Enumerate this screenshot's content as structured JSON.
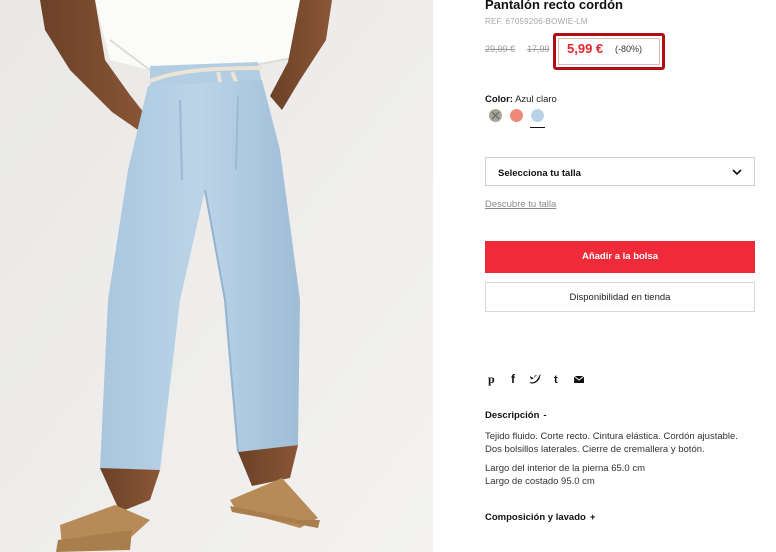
{
  "product": {
    "title": "Pantalón recto cordón",
    "ref": "REF. 67059206-BOWIE-LM",
    "old_prices": [
      "29,99 €",
      "17,99"
    ],
    "sale_price": "5,99 €",
    "discount": "(-80%)"
  },
  "color": {
    "label": "Color:",
    "value": "Azul claro",
    "swatches": [
      {
        "name": "Gris",
        "hex": "#a9a398",
        "available": false
      },
      {
        "name": "Coral",
        "hex": "#ee8a78",
        "available": true
      },
      {
        "name": "Azul claro",
        "hex": "#b9d3e6",
        "available": true,
        "selected": true
      }
    ]
  },
  "size": {
    "select_label": "Selecciona tu talla",
    "guide_link": "Descubre tu talla"
  },
  "actions": {
    "add_to_bag": "Añadir a la bolsa",
    "store_availability": "Disponibilidad en tienda"
  },
  "share_icons": [
    "pinterest-icon",
    "facebook-icon",
    "twitter-icon",
    "tumblr-icon",
    "email-icon"
  ],
  "description": {
    "heading": "Descripción",
    "toggle": "-",
    "lines": [
      "Tejido fluido. Corte recto. Cintura elástica. Cordón ajustable.",
      "Dos bolsillos laterales. Cierre de cremallera y botón.",
      "Largo del interior de la pierna 65.0 cm",
      "Largo de costado 95.0 cm"
    ]
  },
  "composition": {
    "heading": "Composición y lavado",
    "toggle": "+"
  },
  "colors": {
    "accent_red": "#ef2b3a",
    "price_red": "#e2262d",
    "highlight_box": "#b20d12"
  }
}
